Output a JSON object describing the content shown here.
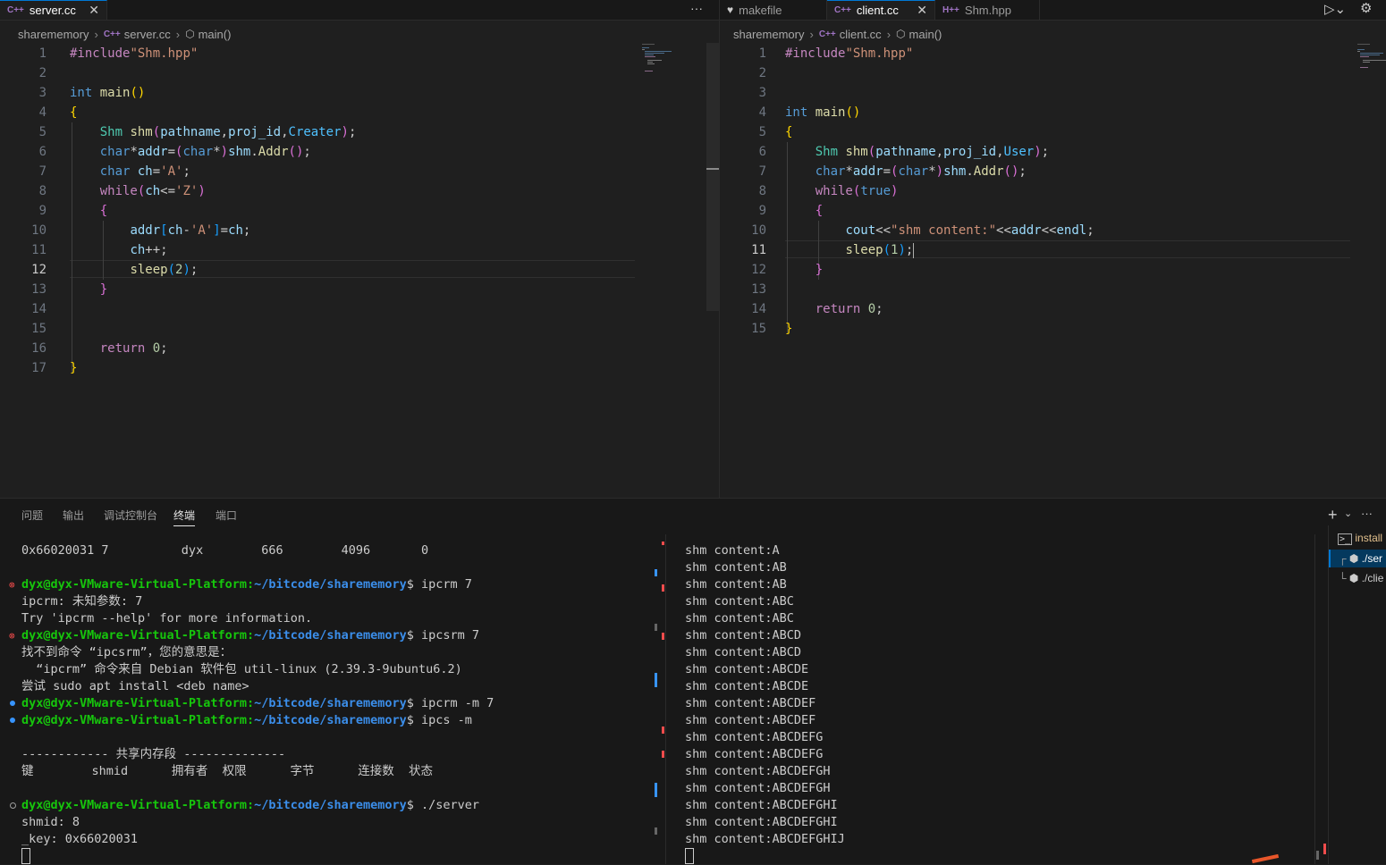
{
  "left_editor": {
    "tabs": [
      {
        "label": "server.cc",
        "icon": "C++",
        "active": true,
        "close": "✕"
      }
    ],
    "more_label": "···",
    "breadcrumb": [
      "sharememory",
      "server.cc",
      "main()"
    ],
    "line_numbers": [
      "1",
      "2",
      "3",
      "4",
      "5",
      "6",
      "7",
      "8",
      "9",
      "10",
      "11",
      "12",
      "13",
      "14",
      "15",
      "16",
      "17"
    ],
    "current_line": "12"
  },
  "right_editor": {
    "tabs": [
      {
        "label": "makefile",
        "icon": "makefile-heart-icon",
        "active": false
      },
      {
        "label": "client.cc",
        "icon": "C++",
        "active": true,
        "close": "✕"
      },
      {
        "label": "Shm.hpp",
        "icon": "H++",
        "active": false
      }
    ],
    "breadcrumb": [
      "sharememory",
      "client.cc",
      "main()"
    ],
    "line_numbers": [
      "1",
      "2",
      "3",
      "4",
      "5",
      "6",
      "7",
      "8",
      "9",
      "10",
      "11",
      "12",
      "13",
      "14",
      "15"
    ],
    "current_line": "11"
  },
  "panel": {
    "tabs": [
      "问题",
      "输出",
      "调试控制台",
      "终端",
      "端口"
    ],
    "active_tab": "终端",
    "add_label": "+",
    "more_label": "···"
  },
  "terminal_left": {
    "lines": [
      {
        "kind": "plain",
        "text": "0x66020031 7          dyx        666        4096       0"
      },
      {
        "kind": "blank",
        "text": ""
      },
      {
        "kind": "prompt",
        "status": "err",
        "user": "dyx@dyx-VMware-Virtual-Platform",
        "path": "~/bitcode/sharememory",
        "cmd": "$ ipcrm 7"
      },
      {
        "kind": "plain",
        "text": "ipcrm: 未知参数: 7"
      },
      {
        "kind": "plain",
        "text": "Try 'ipcrm --help' for more information."
      },
      {
        "kind": "prompt",
        "status": "err",
        "user": "dyx@dyx-VMware-Virtual-Platform",
        "path": "~/bitcode/sharememory",
        "cmd": "$ ipcsrm 7"
      },
      {
        "kind": "plain",
        "text": "找不到命令 “ipcsrm”，您的意思是："
      },
      {
        "kind": "plain",
        "text": "  “ipcrm” 命令来自 Debian 软件包 util-linux (2.39.3-9ubuntu6.2)"
      },
      {
        "kind": "plain",
        "text": "尝试 sudo apt install <deb name>"
      },
      {
        "kind": "prompt",
        "status": "ok",
        "user": "dyx@dyx-VMware-Virtual-Platform",
        "path": "~/bitcode/sharememory",
        "cmd": "$ ipcrm -m 7"
      },
      {
        "kind": "prompt",
        "status": "ok",
        "user": "dyx@dyx-VMware-Virtual-Platform",
        "path": "~/bitcode/sharememory",
        "cmd": "$ ipcs -m"
      },
      {
        "kind": "blank",
        "text": ""
      },
      {
        "kind": "plain",
        "text": "------------ 共享内存段 --------------"
      },
      {
        "kind": "plain",
        "text": "键        shmid      拥有者  权限      字节      连接数  状态"
      },
      {
        "kind": "blank",
        "text": ""
      },
      {
        "kind": "prompt",
        "status": "empty",
        "user": "dyx@dyx-VMware-Virtual-Platform",
        "path": "~/bitcode/sharememory",
        "cmd": "$ ./server"
      },
      {
        "kind": "plain",
        "text": "shmid: 8"
      },
      {
        "kind": "plain",
        "text": "_key: 0x66020031"
      },
      {
        "kind": "cursor",
        "text": ""
      }
    ]
  },
  "terminal_right": {
    "lines": [
      "shm content:A",
      "shm content:AB",
      "shm content:AB",
      "shm content:ABC",
      "shm content:ABC",
      "shm content:ABCD",
      "shm content:ABCD",
      "shm content:ABCDE",
      "shm content:ABCDE",
      "shm content:ABCDEF",
      "shm content:ABCDEF",
      "shm content:ABCDEFG",
      "shm content:ABCDEFG",
      "shm content:ABCDEFGH",
      "shm content:ABCDEFGH",
      "shm content:ABCDEFGHI",
      "shm content:ABCDEFGHI",
      "shm content:ABCDEFGHIJ"
    ]
  },
  "terminal_list": {
    "items": [
      {
        "label": "install",
        "icon": "terminal-icon"
      },
      {
        "label": "./ser",
        "icon": "package-icon",
        "prefix": "┌"
      },
      {
        "label": "./clie",
        "icon": "package-icon",
        "prefix": "└"
      }
    ]
  },
  "colors": {
    "accent": "#0078d4",
    "error": "#f14c4c",
    "ok": "#3794ff",
    "prompt_user": "#16c60c",
    "prompt_path": "#3b8eea"
  }
}
